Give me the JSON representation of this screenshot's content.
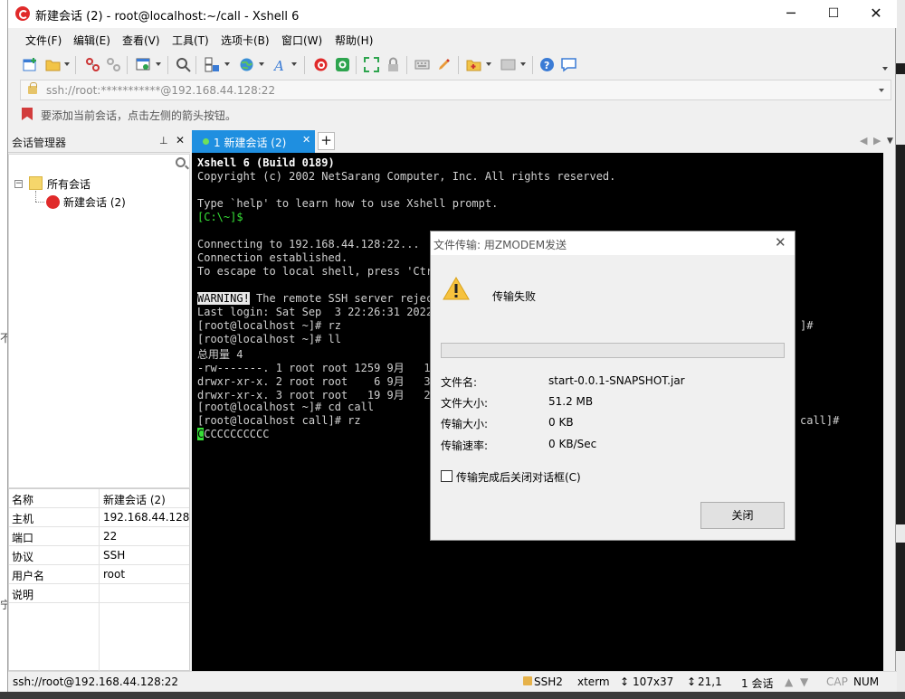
{
  "window": {
    "title": "新建会话 (2) - root@localhost:~/call - Xshell 6",
    "minimize": "─",
    "maximize": "☐",
    "close": "✕"
  },
  "menu": [
    "文件(F)",
    "编辑(E)",
    "查看(V)",
    "工具(T)",
    "选项卡(B)",
    "窗口(W)",
    "帮助(H)"
  ],
  "address": {
    "value": "ssh://root:***********@192.168.44.128:22"
  },
  "hint": {
    "text": "要添加当前会话，点击左侧的箭头按钮。"
  },
  "session_manager": {
    "title": "会话管理器",
    "pin": "⊥",
    "close": "✕",
    "tree": {
      "toggle": "−",
      "root_label": "所有会话",
      "child_label": "新建会话 (2)"
    },
    "properties": [
      {
        "key": "名称",
        "value": "新建会话 (2)"
      },
      {
        "key": "主机",
        "value": "192.168.44.128"
      },
      {
        "key": "端口",
        "value": "22"
      },
      {
        "key": "协议",
        "value": "SSH"
      },
      {
        "key": "用户名",
        "value": "root"
      },
      {
        "key": "说明",
        "value": ""
      }
    ]
  },
  "tabs": {
    "active_label": "1 新建会话 (2)",
    "close": "✕",
    "add": "+",
    "nav_prev": "◀",
    "nav_next": "▶",
    "menu": "▼"
  },
  "terminal": {
    "header": "Xshell 6 (Build 0189)",
    "lines": [
      "Copyright (c) 2002 NetSarang Computer, Inc. All rights reserved.",
      "",
      "Type `help' to learn how to use Xshell prompt.",
      "[C:\\~]$",
      "",
      "Connecting to 192.168.44.128:22...",
      "Connection established.",
      "To escape to local shell, press 'Ctrl",
      "",
      " The remote SSH server reject",
      "Last login: Sat Sep  3 22:26:31 2022",
      "[root@localhost ~]# rz",
      "[root@localhost ~]# ll",
      "总用量 4",
      "-rw-------. 1 root root 1259 9月   1",
      "drwxr-xr-x. 2 root root    6 9月   3",
      "drwxr-xr-x. 3 root root   19 9月   2",
      "[root@localhost ~]# cd call",
      "[root@localhost call]# rz",
      "CCCCCCCCCC"
    ],
    "warning_label": "WARNING!",
    "cursor_char": "C",
    "right_fragment_1": "]#",
    "right_fragment_2": "call]#"
  },
  "status_bar": {
    "connection": "ssh://root@192.168.44.128:22",
    "protocol": "SSH2",
    "terminal_type": "xterm",
    "size": "107x37",
    "cursor": "21,1",
    "sessions": "1 会话",
    "caps": "CAP",
    "num": "NUM"
  },
  "dialog": {
    "title": "文件传输: 用ZMODEM发送",
    "close": "✕",
    "message": "传输失败",
    "progress": 0,
    "fields": [
      {
        "key": "文件名:",
        "value": "start-0.0.1-SNAPSHOT.jar"
      },
      {
        "key": "文件大小:",
        "value": "51.2 MB"
      },
      {
        "key": "传输大小:",
        "value": "0 KB"
      },
      {
        "key": "传输速率:",
        "value": "0 KB/Sec"
      }
    ],
    "checkbox_label": "传输完成后关闭对话框(C)",
    "checkbox_checked": false,
    "close_button": "关闭"
  },
  "colors": {
    "tab_active": "#1f8fe0",
    "terminal_bg": "#000000",
    "prompt_green": "#37e037",
    "brand_red": "#e02a2a"
  }
}
